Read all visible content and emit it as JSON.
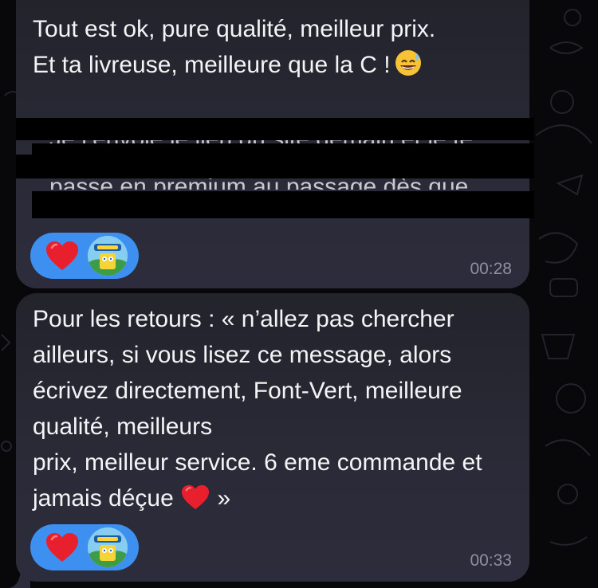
{
  "messages": [
    {
      "text": "Tout est ok, pure qualité, meilleur prix.\nEt ta livreuse, meilleure que la C !",
      "trailing_emoji": "grinning-face-with-sweat-icon",
      "obscured_line_1": "Je t'envoie le lien du site demain et je te",
      "obscured_line_2": "passe en premium au passage dès que",
      "reactions": [
        "heart-icon",
        "avatar"
      ],
      "time": "00:28"
    },
    {
      "text": "Pour les retours : « n’allez pas chercher ailleurs, si vous lisez ce message, alors écrivez directement, Font-Vert, meilleure qualité, meilleurs\nprix, meilleur service. 6 eme commande et jamais déçue",
      "closing_quote": "»",
      "inline_emoji": "red-heart-icon",
      "reactions": [
        "heart-icon",
        "avatar"
      ],
      "time": "00:33"
    }
  ],
  "colors": {
    "background": "#08070a",
    "bubble": "#2a2a37",
    "reaction_pill": "#3d8ff0",
    "heart": "#e81f2d",
    "timestamp": "#8f8fa0",
    "text": "#f4f4f6"
  }
}
